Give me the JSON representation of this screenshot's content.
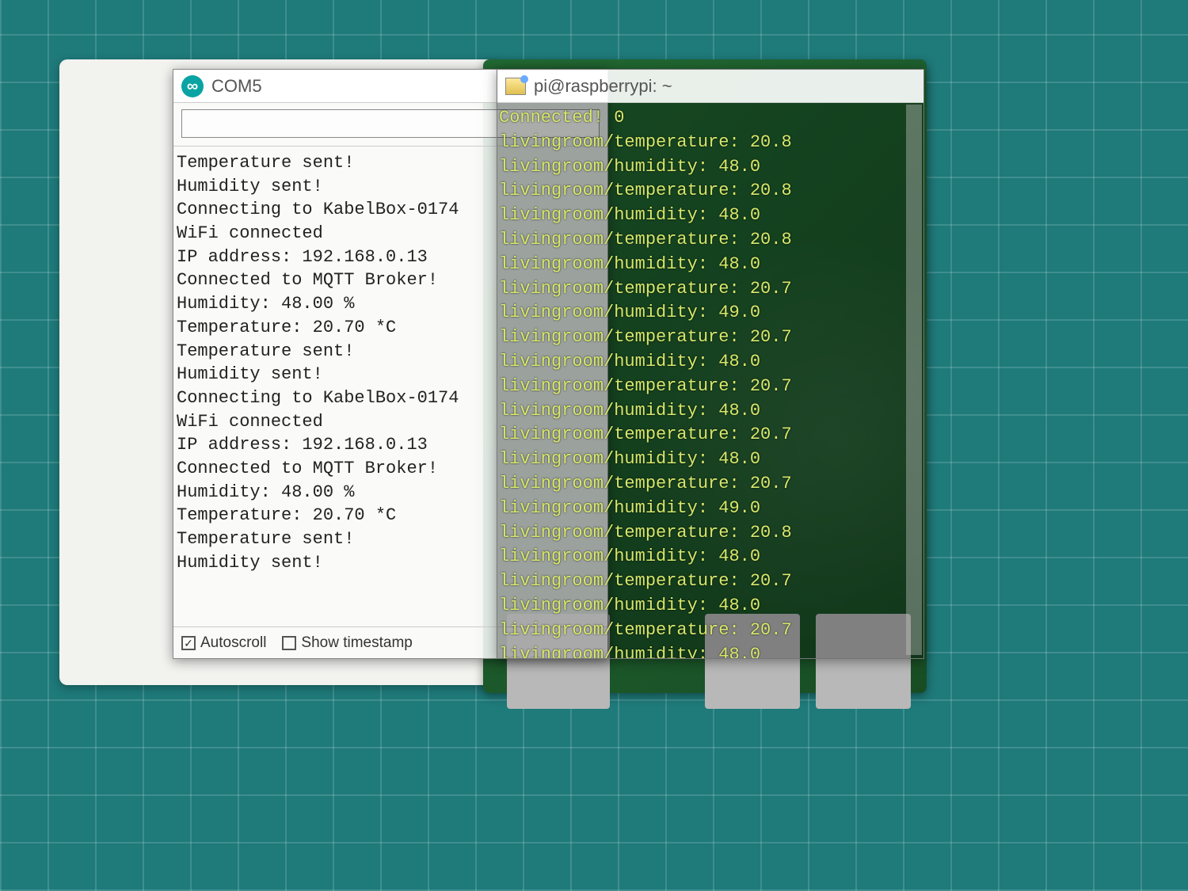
{
  "com5": {
    "title": "COM5",
    "input_value": "",
    "lines": [
      "Temperature sent!",
      "Humidity sent!",
      "Connecting to KabelBox-0174",
      "WiFi connected",
      "IP address: 192.168.0.13",
      "Connected to MQTT Broker!",
      "Humidity: 48.00 %",
      "Temperature: 20.70 *C",
      "Temperature sent!",
      "Humidity sent!",
      "Connecting to KabelBox-0174",
      "WiFi connected",
      "IP address: 192.168.0.13",
      "Connected to MQTT Broker!",
      "Humidity: 48.00 %",
      "Temperature: 20.70 *C",
      "Temperature sent!",
      "Humidity sent!"
    ],
    "autoscroll_label": "Autoscroll",
    "autoscroll_checked": true,
    "timestamp_label": "Show timestamp",
    "timestamp_checked": false
  },
  "putty": {
    "title": "pi@raspberrypi: ~",
    "lines": [
      "Connected! 0",
      "livingroom/temperature: 20.8",
      "livingroom/humidity: 48.0",
      "livingroom/temperature: 20.8",
      "livingroom/humidity: 48.0",
      "livingroom/temperature: 20.8",
      "livingroom/humidity: 48.0",
      "livingroom/temperature: 20.7",
      "livingroom/humidity: 49.0",
      "livingroom/temperature: 20.7",
      "livingroom/humidity: 48.0",
      "livingroom/temperature: 20.7",
      "livingroom/humidity: 48.0",
      "livingroom/temperature: 20.7",
      "livingroom/humidity: 48.0",
      "livingroom/temperature: 20.7",
      "livingroom/humidity: 49.0",
      "livingroom/temperature: 20.8",
      "livingroom/humidity: 48.0",
      "livingroom/temperature: 20.7",
      "livingroom/humidity: 48.0",
      "livingroom/temperature: 20.7",
      "livingroom/humidity: 48.0"
    ]
  }
}
